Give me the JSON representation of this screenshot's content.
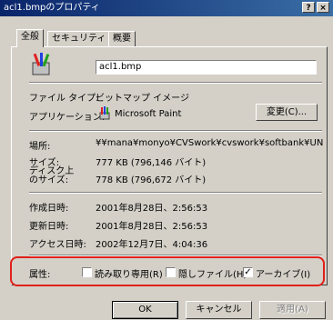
{
  "window": {
    "title": "acl1.bmpのプロパティ",
    "help_btn": "?",
    "close_btn": "×"
  },
  "tabs": [
    {
      "label": "全般"
    },
    {
      "label": "セキュリティ"
    },
    {
      "label": "概要"
    }
  ],
  "file": {
    "name": "acl1.bmp",
    "icon": "paint-icon"
  },
  "props": {
    "type_label": "ファイル タイプ:",
    "type_value": "ビットマップ イメージ",
    "app_label": "アプリケーション:",
    "app_value": "Microsoft Paint",
    "change_btn": "変更(C)...",
    "location_label": "場所:",
    "location_value": "¥¥mana¥monyo¥CVSwork¥cvswork¥softbank¥UNIX_USE",
    "size_label": "サイズ:",
    "size_value": "777 KB (796,146 バイト)",
    "disksize_label1": "ディスク上",
    "disksize_label2": "のサイズ:",
    "disksize_value": "778 KB (796,672 バイト)",
    "created_label": "作成日時:",
    "created_value": "2001年8月28日、2:56:53",
    "modified_label": "更新日時:",
    "modified_value": "2001年8月28日、2:56:53",
    "accessed_label": "アクセス日時:",
    "accessed_value": "2002年12月7日、4:04:36"
  },
  "attributes": {
    "label": "属性:",
    "readonly": {
      "label": "読み取り専用(R)",
      "checked": false
    },
    "hidden": {
      "label": "隠しファイル(H)",
      "checked": false
    },
    "archive": {
      "label": "アーカイブ(I)",
      "checked": true
    }
  },
  "buttons": {
    "ok": "OK",
    "cancel": "キャンセル",
    "apply": "適用(A)"
  },
  "colors": {
    "highlight": "#e0201a",
    "titlebar": "#0a246a"
  }
}
